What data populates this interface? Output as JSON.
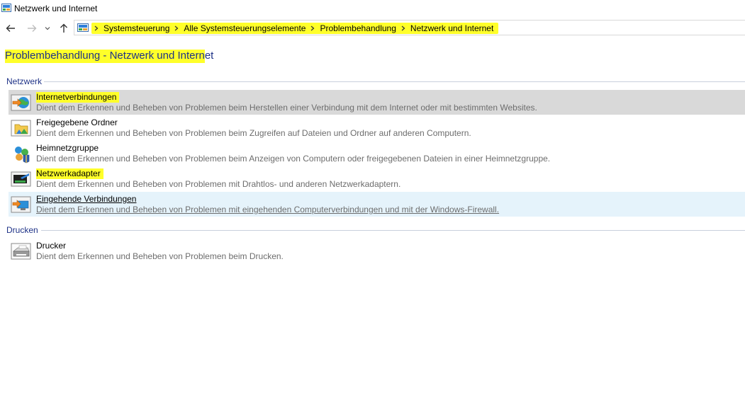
{
  "window": {
    "title": "Netzwerk und Internet"
  },
  "breadcrumb": {
    "items": [
      {
        "label": "Systemsteuerung"
      },
      {
        "label": "Alle Systemsteuerungselemente"
      },
      {
        "label": "Problembehandlung"
      },
      {
        "label": "Netzwerk und Internet"
      }
    ]
  },
  "page": {
    "title_highlighted": "Problembehandlung - Netzwerk und Intern",
    "title_rest": "et"
  },
  "sections": {
    "netzwerk": {
      "header": "Netzwerk",
      "items": [
        {
          "name": "Internetverbindungen",
          "desc": "Dient dem Erkennen und Beheben von Problemen beim Herstellen einer Verbindung mit dem Internet oder mit bestimmten Websites."
        },
        {
          "name": "Freigegebene Ordner",
          "desc": "Dient dem Erkennen und Beheben von Problemen beim Zugreifen auf Dateien und Ordner auf anderen Computern."
        },
        {
          "name": "Heimnetzgruppe",
          "desc": "Dient dem Erkennen und Beheben von Problemen beim Anzeigen von Computern oder freigegebenen Dateien in einer Heimnetzgruppe."
        },
        {
          "name": "Netzwerkadapter",
          "desc": "Dient dem Erkennen und Beheben von Problemen mit Drahtlos- und anderen Netzwerkadaptern."
        },
        {
          "name": "Eingehende Verbindungen",
          "desc": "Dient dem Erkennen und Beheben von Problemen mit eingehenden Computerverbindungen und mit der Windows-Firewall."
        }
      ]
    },
    "drucken": {
      "header": "Drucken",
      "items": [
        {
          "name": "Drucker",
          "desc": "Dient dem Erkennen und Beheben von Problemen beim Drucken."
        }
      ]
    }
  },
  "colors": {
    "highlight": "#ffff2a",
    "link_blue": "#1e3287",
    "selected_bg": "#d9d9d9",
    "hover_bg": "#e5f3fb"
  },
  "icons": {
    "back": "arrow-left-icon",
    "forward": "arrow-right-icon",
    "recent": "chevron-down-icon",
    "up": "arrow-up-icon"
  }
}
